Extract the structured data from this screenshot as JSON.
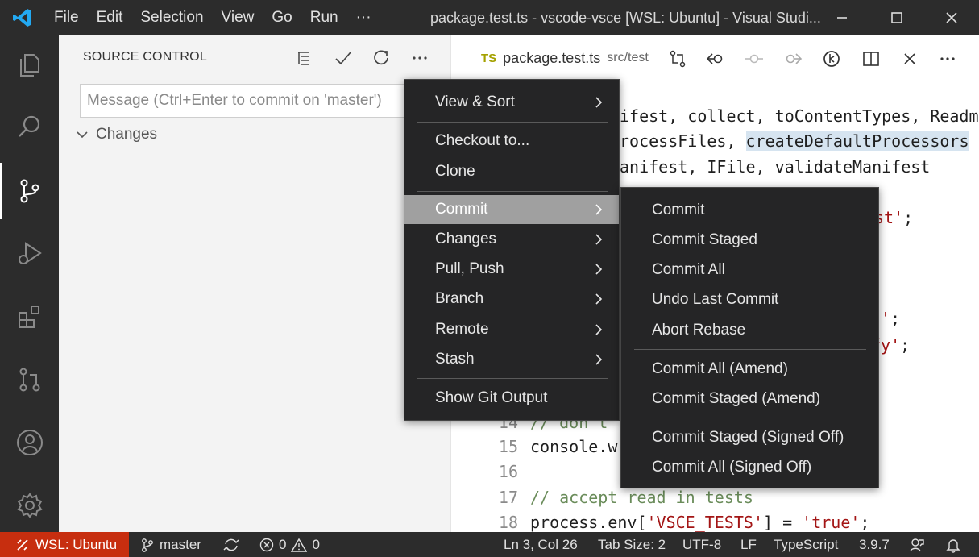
{
  "titlebar": {
    "menu": [
      "File",
      "Edit",
      "Selection",
      "View",
      "Go",
      "Run",
      "···"
    ],
    "window_title": "package.test.ts - vscode-vsce [WSL: Ubuntu] - Visual Studi..."
  },
  "sidebar": {
    "title": "SOURCE CONTROL",
    "commit_placeholder": "Message (Ctrl+Enter to commit on 'master')",
    "changes_label": "Changes"
  },
  "editor": {
    "tab": {
      "badge": "TS",
      "name": "package.test.ts",
      "path": "src/test"
    },
    "visible_lines": [
      {
        "num": "",
        "text": "ifest, collect, toContentTypes, Readm"
      },
      {
        "num": "",
        "text": "rocessFiles, createDefaultProcessors"
      },
      {
        "num": "",
        "text": "anifest, IFile, validateManifest"
      },
      {
        "num": "",
        "text": "st';"
      },
      {
        "num": "",
        "text": "';"
      },
      {
        "num": "",
        "text": "fy';"
      },
      {
        "num": "14",
        "text": "// don't"
      },
      {
        "num": "15",
        "text": "console.w"
      },
      {
        "num": "16",
        "text": ""
      },
      {
        "num": "17",
        "text": "// accept read in tests"
      },
      {
        "num": "18",
        "text": "process.env['VSCE_TESTS'] = 'true';"
      }
    ]
  },
  "main_menu": {
    "items": [
      {
        "label": "View & Sort",
        "submenu": true
      },
      {
        "label": "Checkout to...",
        "submenu": false
      },
      {
        "label": "Clone",
        "submenu": false
      },
      {
        "label": "Commit",
        "submenu": true,
        "selected": true
      },
      {
        "label": "Changes",
        "submenu": true
      },
      {
        "label": "Pull, Push",
        "submenu": true
      },
      {
        "label": "Branch",
        "submenu": true
      },
      {
        "label": "Remote",
        "submenu": true
      },
      {
        "label": "Stash",
        "submenu": true
      },
      {
        "label": "Show Git Output",
        "submenu": false
      }
    ]
  },
  "commit_menu": {
    "items": [
      "Commit",
      "Commit Staged",
      "Commit All",
      "Undo Last Commit",
      "Abort Rebase",
      "Commit All (Amend)",
      "Commit Staged (Amend)",
      "Commit Staged (Signed Off)",
      "Commit All (Signed Off)"
    ]
  },
  "statusbar": {
    "remote": "WSL: Ubuntu",
    "branch": "master",
    "errors": "0",
    "warnings": "0",
    "position": "Ln 3, Col 26",
    "tab_size": "Tab Size: 2",
    "encoding": "UTF-8",
    "eol": "LF",
    "language": "TypeScript",
    "ts_version": "3.9.7"
  },
  "colors": {
    "titlebar_bg": "#2c2c2c",
    "remote_bg": "#c72e0f",
    "menu_bg": "#252526",
    "menu_selected_bg": "#a0a0a0",
    "accent": "#23a9f2"
  }
}
